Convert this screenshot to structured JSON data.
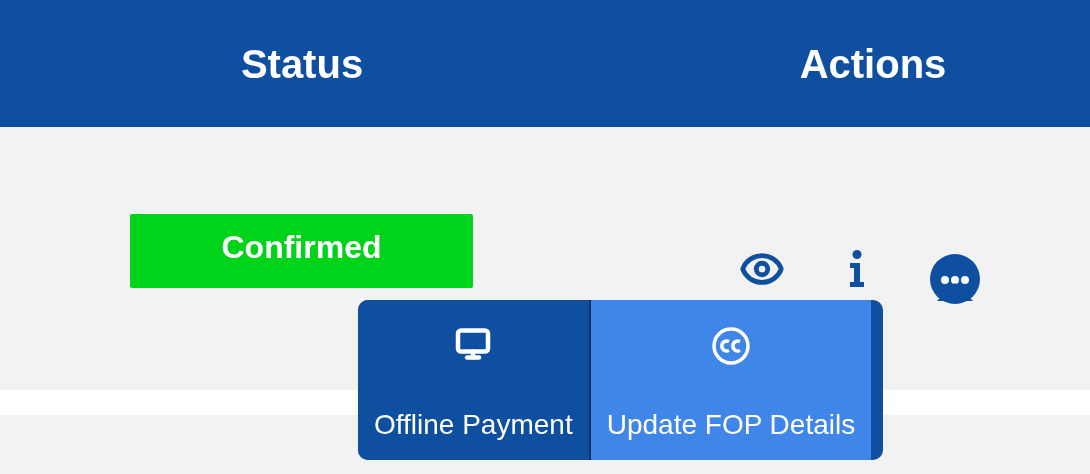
{
  "table": {
    "columns": [
      "Status",
      "Actions"
    ],
    "rows": [
      {
        "status": "Confirmed"
      }
    ]
  },
  "menu": {
    "items": [
      {
        "kind": "monitor",
        "label": "Offline Payment",
        "selected": false
      },
      {
        "kind": "captions",
        "label": "Update FOP Details",
        "selected": true
      }
    ]
  }
}
